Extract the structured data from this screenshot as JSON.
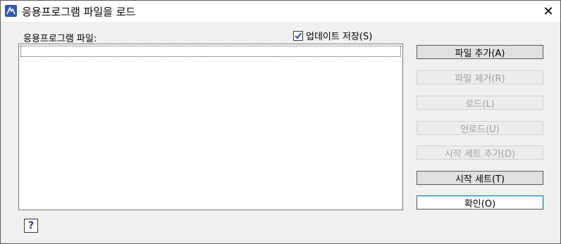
{
  "window": {
    "title": "응용프로그램 파일을 로드",
    "close_glyph": "✕"
  },
  "label_files": "응용프로그램 파일:",
  "update_checkbox": {
    "label": "업데이트 저장(S)",
    "checked": true
  },
  "buttons": {
    "add_file": "파일 추가(A)",
    "remove_file": "파일 제거(R)",
    "load": "로드(L)",
    "unload": "언로드(U)",
    "startup_add": "시작 세트 추가(D)",
    "startup_set": "시작 세트(T)",
    "ok": "확인(O)"
  },
  "help_glyph": "?"
}
